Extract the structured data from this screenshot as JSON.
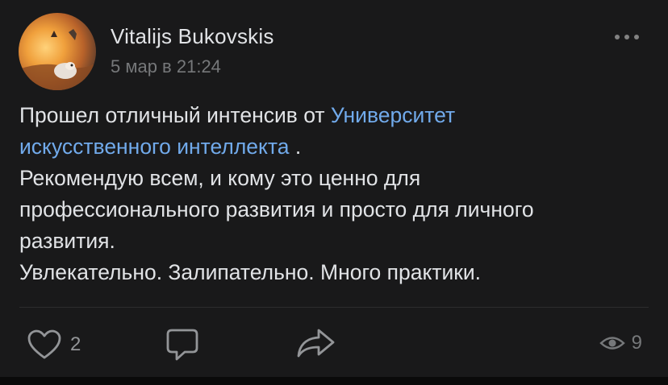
{
  "post": {
    "author": "Vitalijs Bukovskis",
    "timestamp": "5 мар в 21:24",
    "text": {
      "line1_prefix": "Прошел отличный интенсив от ",
      "line1_link": "Университет",
      "line2_link": "искусственного интеллекта",
      "line2_suffix": " .",
      "line3": "Рекомендую всем, и кому это ценно для",
      "line4": "профессионального развития и просто для личного",
      "line5": "развития.",
      "line6": "Увлекательно. Залипательно. Много практики."
    },
    "actions": {
      "likes": "2",
      "views": "9"
    }
  },
  "icons": {
    "more": "more-horizontal-icon",
    "like": "heart-outline-icon",
    "comment": "comment-bubble-icon",
    "share": "share-arrow-icon",
    "views": "eye-icon"
  },
  "colors": {
    "background": "#19191a",
    "text": "#e1e3e6",
    "link": "#71aaeb",
    "secondary": "#76787a"
  }
}
